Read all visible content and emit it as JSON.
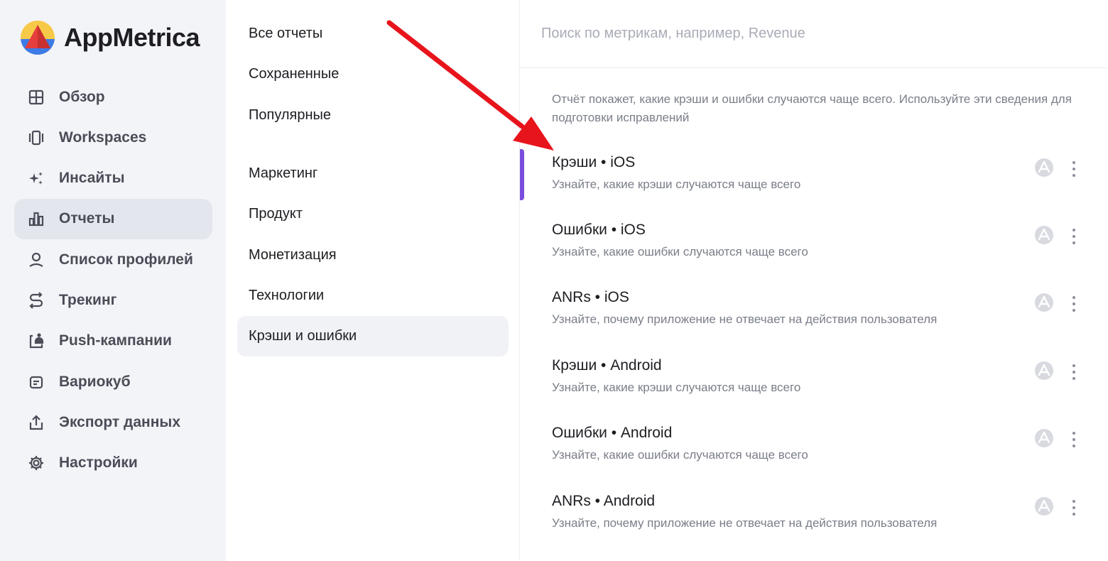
{
  "app": {
    "name": "AppMetrica",
    "brand_colors": [
      "#f7c948",
      "#e63d3d",
      "#3d7be6",
      "#7b4ddf"
    ]
  },
  "sidebar": {
    "items": [
      {
        "label": "Обзор",
        "icon": "grid-icon",
        "active": false
      },
      {
        "label": "Workspaces",
        "icon": "cards-icon",
        "active": false
      },
      {
        "label": "Инсайты",
        "icon": "sparkles-icon",
        "active": false
      },
      {
        "label": "Отчеты",
        "icon": "bar-chart-icon",
        "active": true
      },
      {
        "label": "Список профилей",
        "icon": "profile-icon",
        "active": false
      },
      {
        "label": "Трекинг",
        "icon": "route-icon",
        "active": false
      },
      {
        "label": "Push-кампании",
        "icon": "push-bell-icon",
        "active": false
      },
      {
        "label": "Вариокуб",
        "icon": "variocube-icon",
        "active": false
      },
      {
        "label": "Экспорт данных",
        "icon": "export-icon",
        "active": false
      },
      {
        "label": "Настройки",
        "icon": "gear-icon",
        "active": false
      }
    ]
  },
  "categories": {
    "items": [
      {
        "label": "Все отчеты",
        "active": false
      },
      {
        "label": "Сохраненные",
        "active": false
      },
      {
        "label": "Популярные",
        "active": false
      },
      {
        "label": "Маркетинг",
        "active": false
      },
      {
        "label": "Продукт",
        "active": false
      },
      {
        "label": "Монетизация",
        "active": false
      },
      {
        "label": "Технологии",
        "active": false
      },
      {
        "label": "Крэши и ошибки",
        "active": true
      }
    ]
  },
  "search": {
    "placeholder": "Поиск по метрикам, например, Revenue",
    "value": ""
  },
  "description": "Отчёт покажет, какие крэши и ошибки случаются чаще всего. Используйте эти сведения для подготовки исправлений",
  "reports": [
    {
      "title": "Крэши • iOS",
      "subtitle": "Узнайте, какие крэши случаются чаще всего",
      "highlighted": true
    },
    {
      "title": "Ошибки • iOS",
      "subtitle": "Узнайте, какие ошибки случаются чаще всего",
      "highlighted": false
    },
    {
      "title": "ANRs • iOS",
      "subtitle": "Узнайте, почему приложение не отвечает на действия пользователя",
      "highlighted": false
    },
    {
      "title": "Крэши • Android",
      "subtitle": "Узнайте, какие крэши случаются чаще всего",
      "highlighted": false
    },
    {
      "title": "Ошибки • Android",
      "subtitle": "Узнайте, какие ошибки случаются чаще всего",
      "highlighted": false
    },
    {
      "title": "ANRs • Android",
      "subtitle": "Узнайте, почему приложение не отвечает на действия пользователя",
      "highlighted": false
    }
  ],
  "annotation": {
    "arrow_color": "#e8141c"
  }
}
